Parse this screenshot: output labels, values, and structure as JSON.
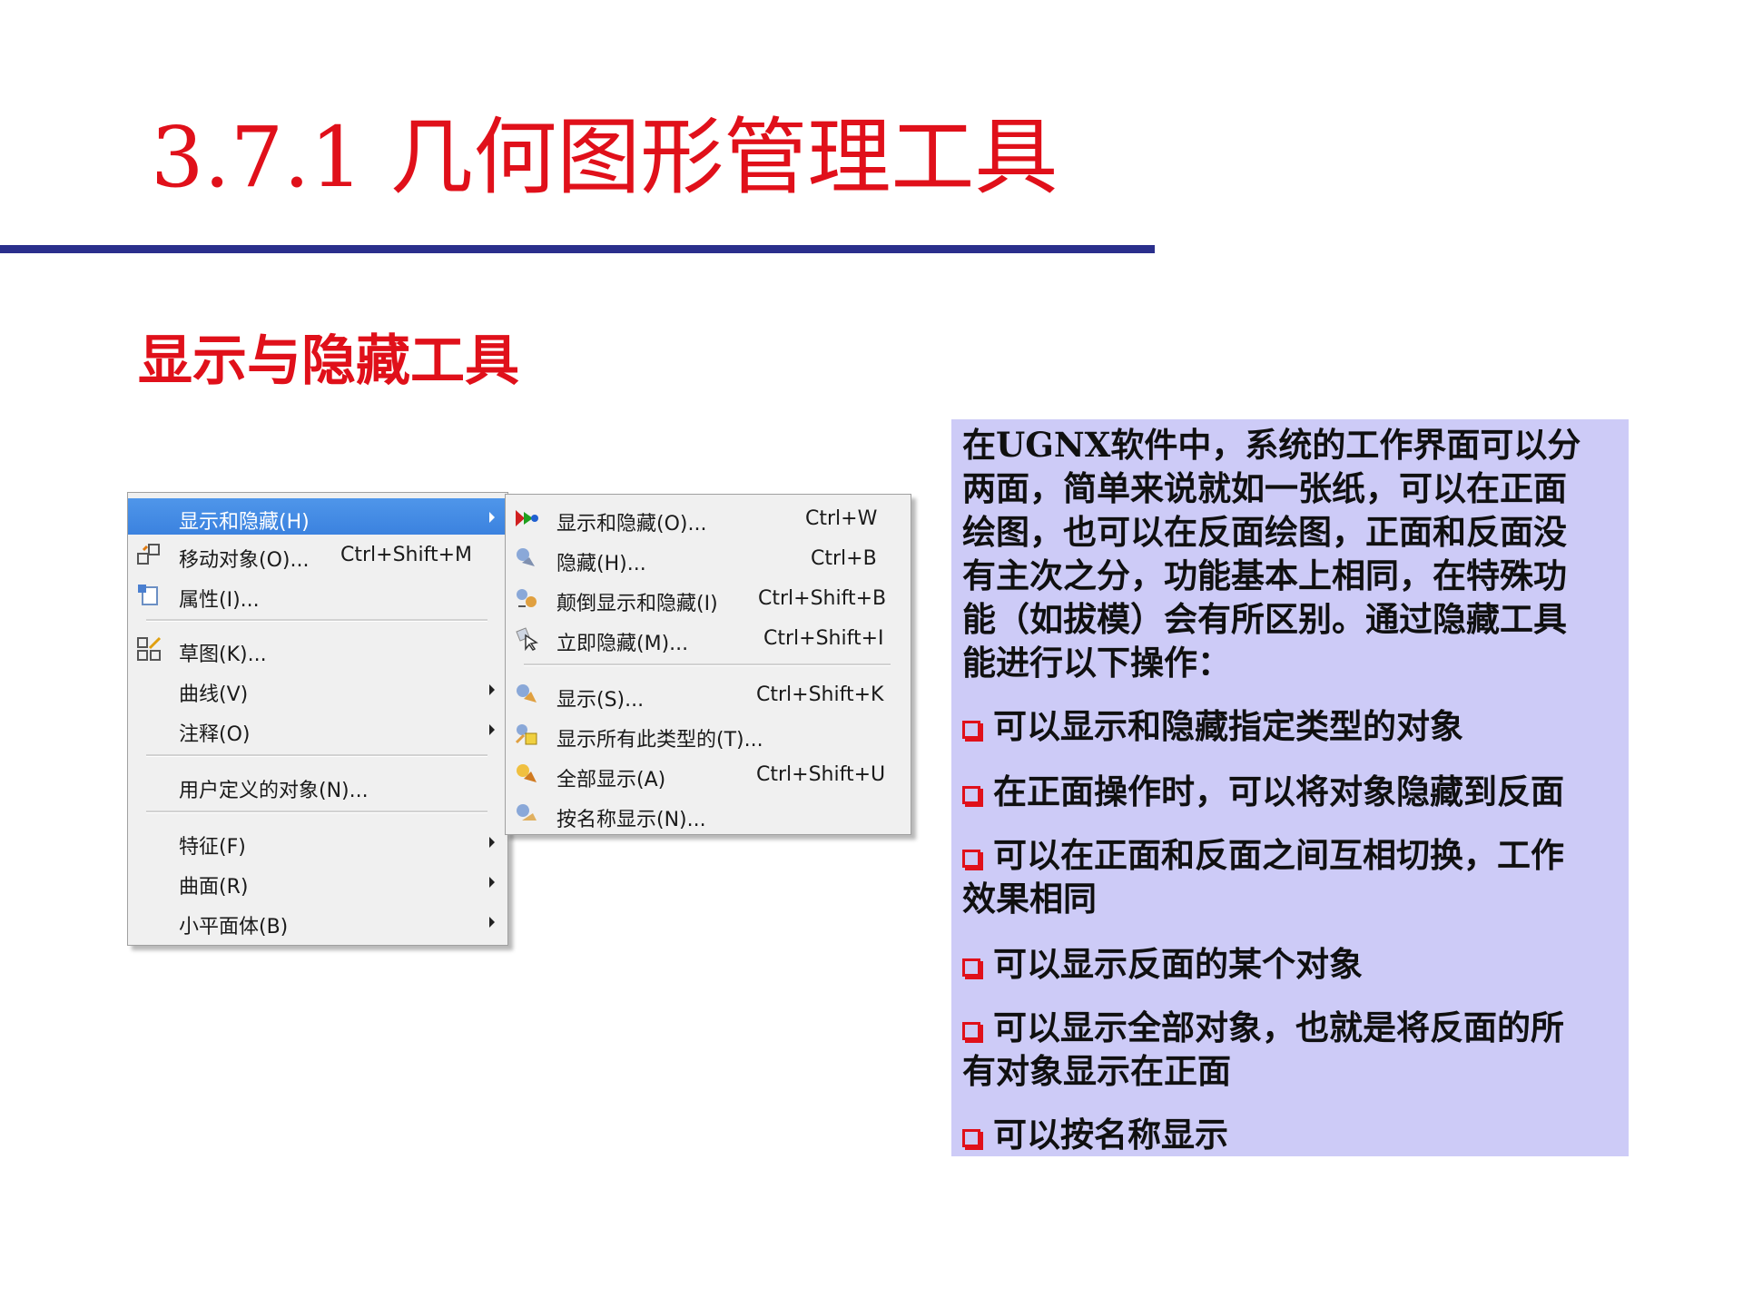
{
  "slide": {
    "title": "3.7.1  几何图形管理工具",
    "subtitle": "显示与隐藏工具"
  },
  "main_menu": {
    "items": [
      {
        "label": "显示和隐藏(H)",
        "shortcut": "",
        "submenu": true,
        "highlighted": true,
        "icon": ""
      },
      {
        "label": "移动对象(O)...",
        "shortcut": "Ctrl+Shift+M",
        "submenu": false,
        "icon": "move-object-icon"
      },
      {
        "label": "属性(I)...",
        "shortcut": "",
        "submenu": false,
        "icon": "properties-icon"
      },
      {
        "label": "草图(K)...",
        "shortcut": "",
        "submenu": false,
        "icon": "sketch-icon"
      },
      {
        "label": "曲线(V)",
        "shortcut": "",
        "submenu": true,
        "icon": ""
      },
      {
        "label": "注释(O)",
        "shortcut": "",
        "submenu": true,
        "icon": ""
      },
      {
        "label": "用户定义的对象(N)...",
        "shortcut": "",
        "submenu": false,
        "icon": ""
      },
      {
        "label": "特征(F)",
        "shortcut": "",
        "submenu": true,
        "icon": ""
      },
      {
        "label": "曲面(R)",
        "shortcut": "",
        "submenu": true,
        "icon": ""
      },
      {
        "label": "小平面体(B)",
        "shortcut": "",
        "submenu": true,
        "icon": ""
      }
    ]
  },
  "sub_menu": {
    "items": [
      {
        "label": "显示和隐藏(O)...",
        "shortcut": "Ctrl+W",
        "icon": "show-hide-icon"
      },
      {
        "label": "隐藏(H)...",
        "shortcut": "Ctrl+B",
        "icon": "hide-icon"
      },
      {
        "label": "颠倒显示和隐藏(I)",
        "shortcut": "Ctrl+Shift+B",
        "icon": "invert-show-hide-icon"
      },
      {
        "label": "立即隐藏(M)...",
        "shortcut": "Ctrl+Shift+I",
        "icon": "immediate-hide-icon"
      },
      {
        "label": "显示(S)...",
        "shortcut": "Ctrl+Shift+K",
        "icon": "show-icon"
      },
      {
        "label": "显示所有此类型的(T)...",
        "shortcut": "",
        "icon": "show-all-of-type-icon"
      },
      {
        "label": "全部显示(A)",
        "shortcut": "Ctrl+Shift+U",
        "icon": "show-all-icon"
      },
      {
        "label": "按名称显示(N)...",
        "shortcut": "",
        "icon": "show-by-name-icon"
      }
    ]
  },
  "panel": {
    "intro_lines": [
      "在UGNX软件中，系统的工作界面可以分",
      "两面，简单来说就如一张纸，可以在正面",
      "绘图，也可以在反面绘图，正面和反面没",
      "有主次之分，功能基本上相同，在特殊功",
      "能（如拔模）会有所区别。通过隐藏工具",
      "能进行以下操作："
    ],
    "bullets": [
      {
        "lines": [
          "可以显示和隐藏指定类型的对象"
        ]
      },
      {
        "lines": [
          "在正面操作时，可以将对象隐藏到反面"
        ]
      },
      {
        "lines": [
          "可以在正面和反面之间互相切换，工作",
          "效果相同"
        ]
      },
      {
        "lines": [
          "可以显示反面的某个对象"
        ]
      },
      {
        "lines": [
          "可以显示全部对象，也就是将反面的所",
          "有对象显示在正面"
        ]
      },
      {
        "lines": [
          "可以按名称显示"
        ]
      }
    ],
    "background": "#cdcbf7",
    "bullet_color": "#e0101a"
  },
  "colors": {
    "title": "#e0101a",
    "rule": "#2a2f8c",
    "menu_highlight": "#3b82df"
  }
}
